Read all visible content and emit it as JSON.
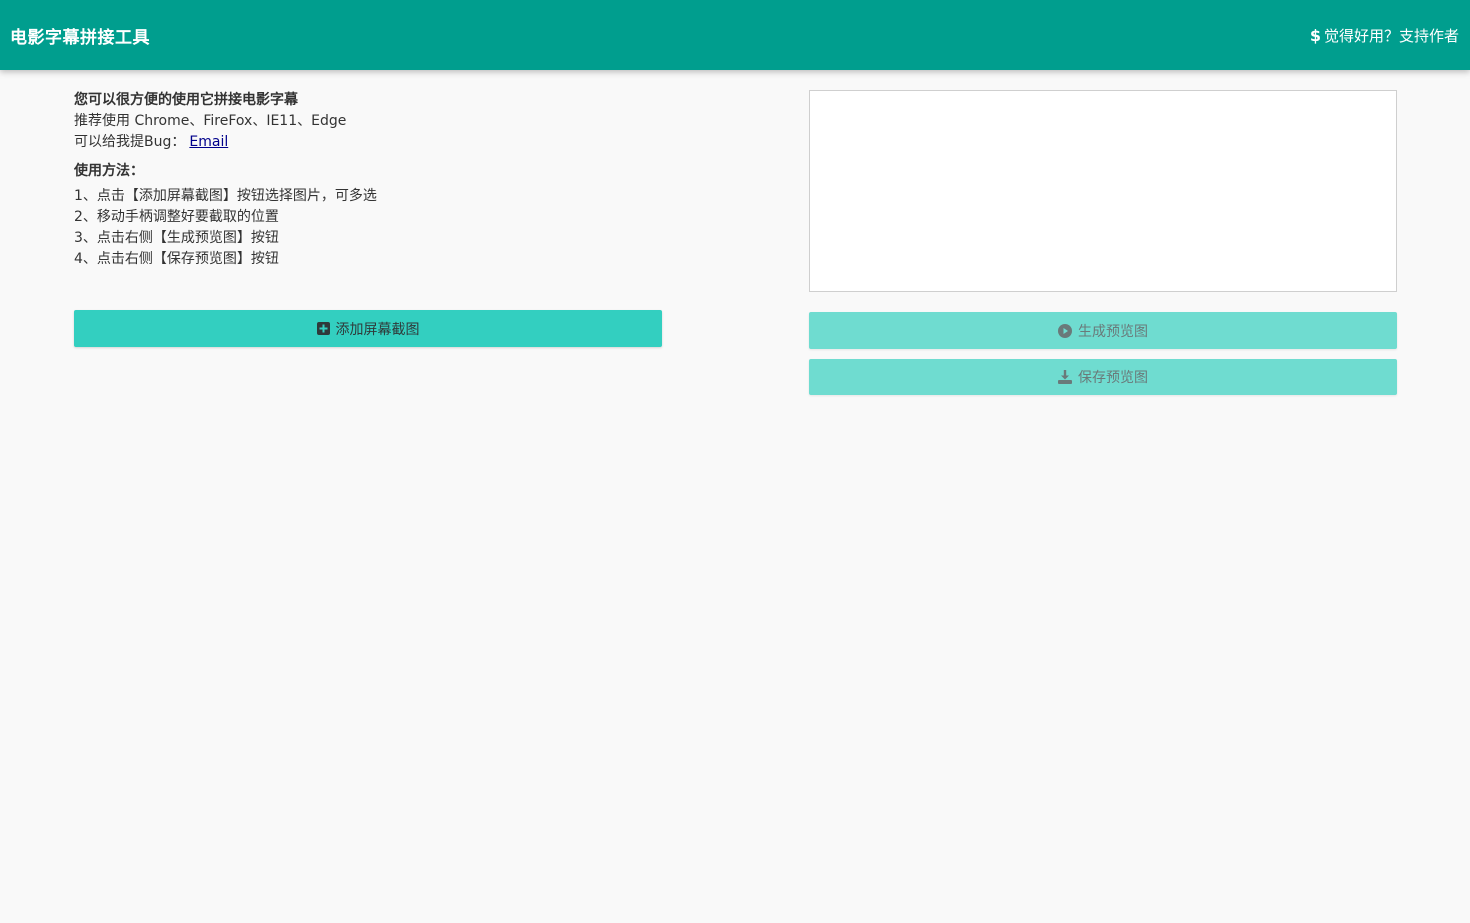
{
  "navbar": {
    "title": "电影字幕拼接工具",
    "support_icon": "$",
    "support_label": "觉得好用？支持作者"
  },
  "intro": {
    "headline": "您可以很方便的使用它拼接电影字幕",
    "browsers": "推荐使用 Chrome、FireFox、IE11、Edge",
    "bug_prefix": "可以给我提Bug：",
    "email_label": "Email"
  },
  "usage": {
    "title": "使用方法：",
    "steps": [
      "1、点击【添加屏幕截图】按钮选择图片，可多选",
      "2、移动手柄调整好要截取的位置",
      "3、点击右侧【生成预览图】按钮",
      "4、点击右侧【保存预览图】按钮"
    ]
  },
  "buttons": {
    "add_label": "添加屏幕截图",
    "add_icon": "plus-square-icon",
    "generate_label": "生成预览图",
    "generate_icon": "play-circle-icon",
    "save_label": "保存预览图",
    "save_icon": "download-icon"
  },
  "colors": {
    "navbar": "#009e8e",
    "primary_button": "#33cfc0",
    "disabled_button": "#6fdcd0",
    "background": "#f9f9f9"
  }
}
